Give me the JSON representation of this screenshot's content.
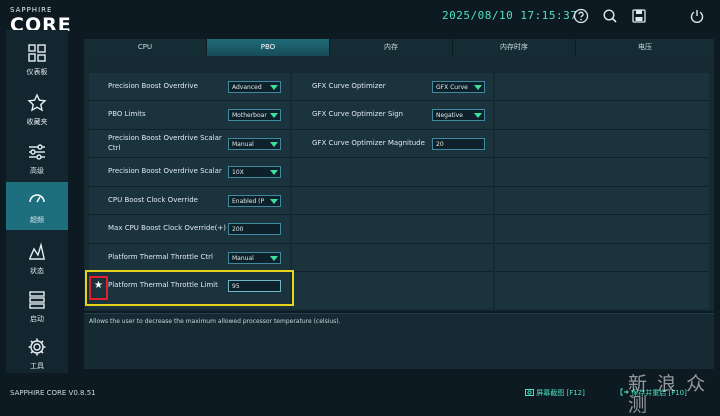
{
  "brand": {
    "top": "SAPPHIRE",
    "main": "CORE"
  },
  "header": {
    "datetime": "2025/08/10 17:15:37"
  },
  "top_icons": [
    "help-icon",
    "search-icon",
    "save-icon",
    "power-icon"
  ],
  "sidebar": {
    "items": [
      {
        "label": "仪表板",
        "icon": "dashboard-icon"
      },
      {
        "label": "收藏夹",
        "icon": "star-icon"
      },
      {
        "label": "高级",
        "icon": "sliders-icon"
      },
      {
        "label": "超频",
        "icon": "gauge-icon",
        "active": true
      },
      {
        "label": "状态",
        "icon": "chart-icon"
      },
      {
        "label": "启动",
        "icon": "stack-icon"
      },
      {
        "label": "工具",
        "icon": "gear-icon"
      }
    ]
  },
  "tabs": [
    {
      "label": "CPU"
    },
    {
      "label": "PBO",
      "active": true
    },
    {
      "label": "内存"
    },
    {
      "label": "内存时序"
    },
    {
      "label": "电压"
    }
  ],
  "left_settings": [
    {
      "label": "Precision Boost Overdrive",
      "type": "dropdown",
      "value": "Advanced"
    },
    {
      "label": "PBO Limits",
      "type": "dropdown",
      "value": "Motherboar"
    },
    {
      "label": "Precision Boost Overdrive Scalar",
      "label2": "Ctrl",
      "type": "dropdown",
      "value": "Manual"
    },
    {
      "label": "Precision Boost Overdrive Scalar",
      "type": "dropdown",
      "value": "10X"
    },
    {
      "label": "CPU Boost Clock Override",
      "type": "dropdown",
      "value": "Enabled (P"
    },
    {
      "label": "Max CPU Boost Clock Override(+)",
      "type": "input",
      "value": "200"
    },
    {
      "label": "Platform Thermal Throttle Ctrl",
      "type": "dropdown",
      "value": "Manual"
    },
    {
      "label": "Platform Thermal Throttle Limit",
      "type": "input",
      "value": "95"
    }
  ],
  "right_settings": [
    {
      "label": "GFX Curve Optimizer",
      "type": "dropdown",
      "value": "GFX Curve"
    },
    {
      "label": "GFX Curve Optimizer Sign",
      "type": "dropdown",
      "value": "Negative"
    },
    {
      "label": "GFX Curve Optimizer Magnitude",
      "type": "input",
      "value": "20"
    }
  ],
  "description": "Allows the user to decrease the maximum allowed processor temperature (celsius).",
  "footer": {
    "version": "SAPPHIRE CORE V0.8.51",
    "screenshot": "屏幕截图 [F12]",
    "save_reset": "保存并重启 [F10]"
  },
  "star_marker": "★",
  "watermark": "新 浪 众测",
  "colors": {
    "accent": "#4fe0c2",
    "active_tab": "#1f6b78",
    "highlight_yellow": "#e8d21a",
    "highlight_red": "#e0202a"
  }
}
